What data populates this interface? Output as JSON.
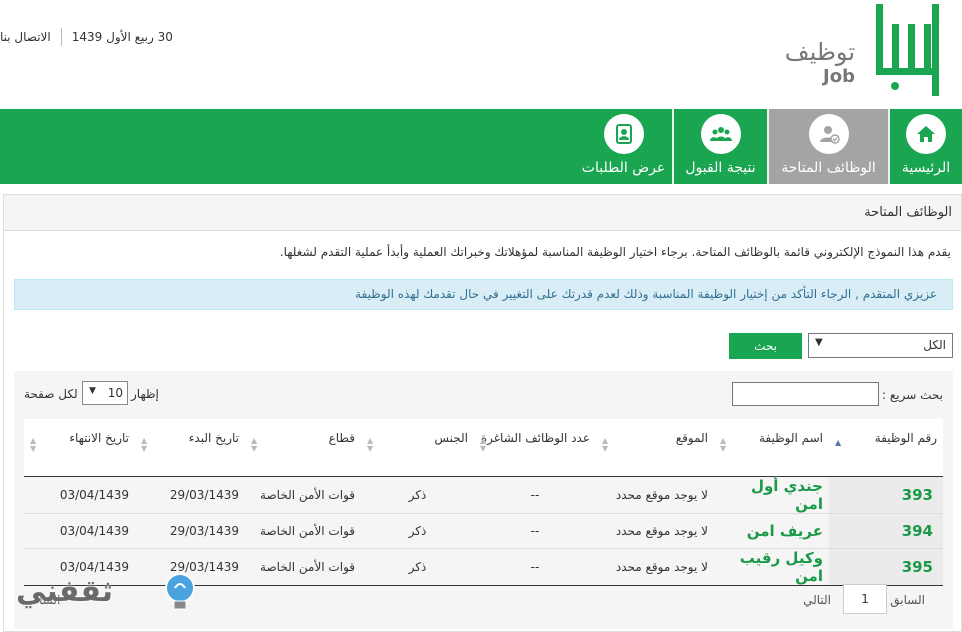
{
  "header": {
    "logo_ar": "توظيف",
    "logo_en": "Job",
    "date": "30 ربيع الأول 1439",
    "contact_label": "الاتصال بنا"
  },
  "nav": {
    "items": [
      {
        "label": "الرئيسية",
        "icon": "home-icon",
        "active": false
      },
      {
        "label": "الوظائف المتاحة",
        "icon": "user-badge-icon",
        "active": true
      },
      {
        "label": "نتيجة القبول",
        "icon": "group-icon",
        "active": false
      },
      {
        "label": "عرض الطلبات",
        "icon": "document-user-icon",
        "active": false
      }
    ]
  },
  "panel": {
    "title": "الوظائف المتاحة",
    "intro": "يقدم هذا النموذج الإلكتروني قائمة بالوظائف المتاحة. برجاء اختيار الوظيفة المناسبة لمؤهلاتك وخبراتك العملية وأبدأ عملية التقدم لشغلها.",
    "alert": "عزيزي المتقدم , الرجاء التأكد من إختيار الوظيفة المناسبة وذلك لعدم قدرتك على التغيير في حال تقدمك لهذه الوظيفة"
  },
  "filter": {
    "selected": "الكل",
    "search_button": "بحث"
  },
  "table_controls": {
    "quick_search_label": "بحث سريع :",
    "show_label": "إظهار",
    "page_length": "10",
    "per_page_label": "لكل صفحة"
  },
  "table": {
    "columns": [
      "رقم الوظيفة",
      "اسم الوظيفة",
      "الموقع",
      "عدد الوظائف الشاغرة",
      "الجنس",
      "قطاع",
      "تاريخ البدء",
      "تاريخ الانتهاء"
    ],
    "rows": [
      {
        "num": "393",
        "name": "جندي أول امن",
        "location": "لا يوجد موقع محدد",
        "vacancies": "--",
        "gender": "ذكر",
        "sector": "قوات الأمن الخاصة",
        "start": "29/03/1439",
        "end": "03/04/1439"
      },
      {
        "num": "394",
        "name": "عريف امن",
        "location": "لا يوجد موقع محدد",
        "vacancies": "--",
        "gender": "ذكر",
        "sector": "قوات الأمن الخاصة",
        "start": "29/03/1439",
        "end": "03/04/1439"
      },
      {
        "num": "395",
        "name": "وكيل رقيب امن",
        "location": "لا يوجد موقع محدد",
        "vacancies": "--",
        "gender": "ذكر",
        "sector": "قوات الأمن الخاصة",
        "start": "29/03/1439",
        "end": "03/04/1439"
      }
    ]
  },
  "pager": {
    "prev": "السابق",
    "page": "1",
    "next": "التالي",
    "info": "السا"
  },
  "watermark": {
    "text": "ثقفني"
  },
  "colors": {
    "brand_green": "#1aa551",
    "active_tab": "#a4a4a4",
    "alert_bg": "#d9edf7",
    "alert_text": "#31708f"
  }
}
